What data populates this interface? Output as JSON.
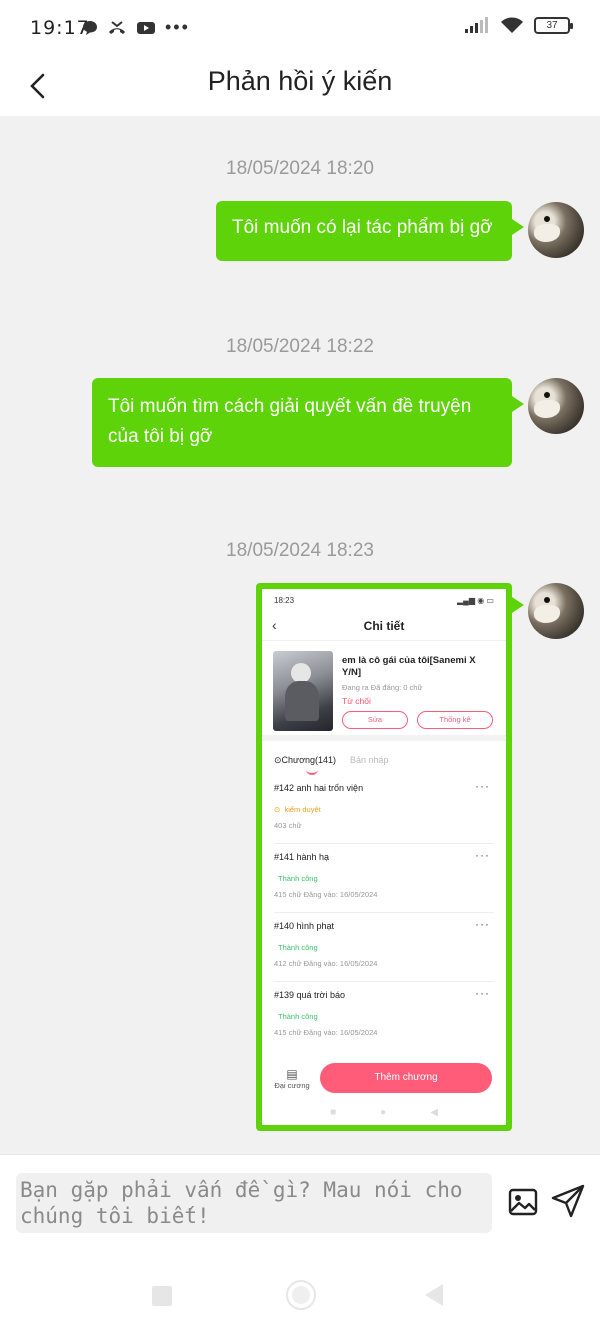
{
  "status_bar": {
    "time": "19:17",
    "battery": "37"
  },
  "header": {
    "title": "Phản hồi ý kiến"
  },
  "messages": [
    {
      "timestamp": "18/05/2024 18:20",
      "text": "Tôi muốn có lại tác phẩm bị gỡ"
    },
    {
      "timestamp": "18/05/2024 18:22",
      "text": "Tôi muốn tìm cách giải quyết vấn đề truyện của tôi bị gỡ"
    },
    {
      "timestamp": "18/05/2024 18:23",
      "attachment": "screenshot"
    }
  ],
  "screenshot": {
    "status_time": "18:23",
    "title": "Chi tiết",
    "book": {
      "title": "em là cô gái của tôi[Sanemi X Y/N]",
      "meta": "Đang ra   Đã đăng: 0 chữ",
      "status": "Từ chối",
      "edit_label": "Sửa",
      "stats_label": "Thống kê"
    },
    "tabs": {
      "chapters": "Chương(141)",
      "drafts": "Bản nháp"
    },
    "chapters": [
      {
        "title": "#142  anh hai trốn viện",
        "status": "kiểm duyệt",
        "meta": "403 chữ"
      },
      {
        "title": "#141  hành hạ",
        "status": "Thành công",
        "meta": "415 chữ   Đăng vào:  16/05/2024"
      },
      {
        "title": "#140  hình phạt",
        "status": "Thành công",
        "meta": "412 chữ   Đăng vào:  16/05/2024"
      },
      {
        "title": "#139  quá trời báo",
        "status": "Thành công",
        "meta": "415 chữ   Đăng vào:  16/05/2024"
      }
    ],
    "outline_label": "Đại cương",
    "add_chapter_label": "Thêm chương",
    "colors": {
      "pending": "#f0a020",
      "success": "#3cc06a",
      "accent": "#ff5c7a"
    }
  },
  "input": {
    "placeholder": "Bạn gặp phải vấn đề gì? Mau nói cho chúng tôi biết!"
  },
  "icons": {
    "image": "image-icon",
    "send": "send-icon"
  },
  "colors": {
    "bubble": "#5fd30a",
    "background": "#f1f1f1"
  }
}
